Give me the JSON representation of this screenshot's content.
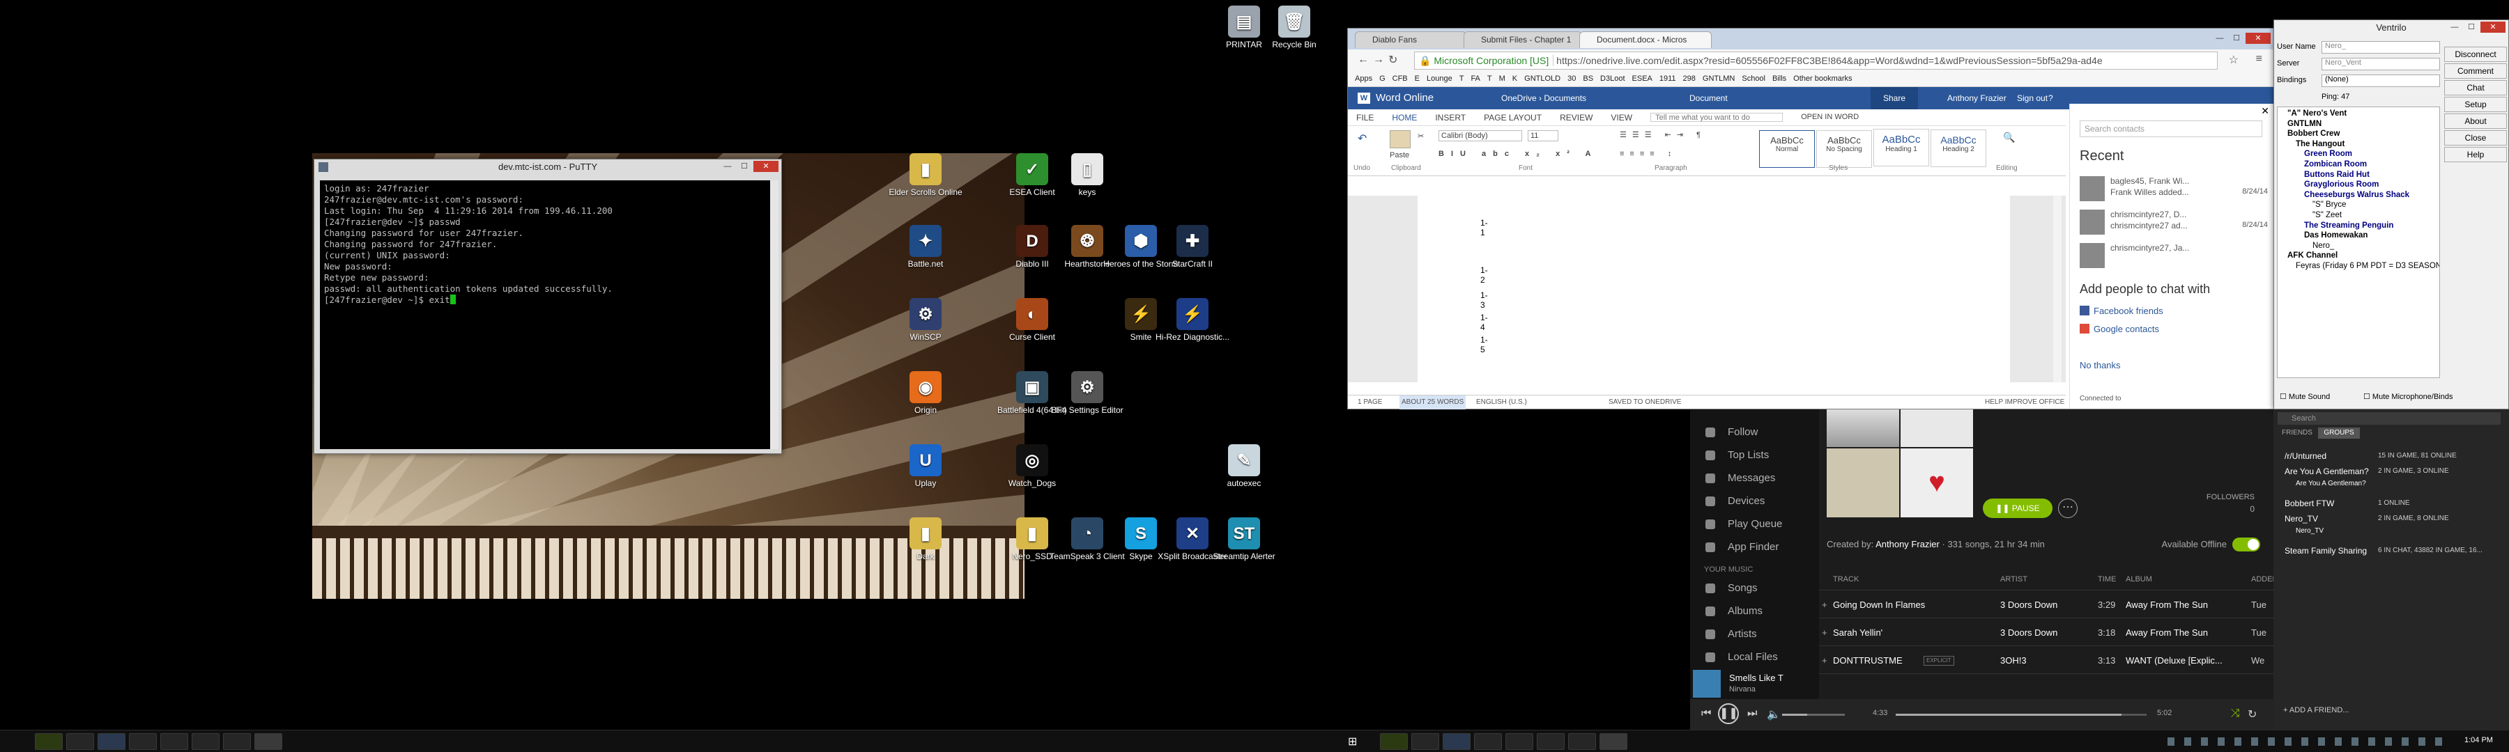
{
  "desktop": {
    "icons": [
      {
        "label": "PRINTAR",
        "glyph": "▤",
        "color": "#9aa3ad"
      },
      {
        "label": "Recycle Bin",
        "glyph": "🗑",
        "color": "#b8c4cc"
      },
      {
        "label": "Elder Scrolls Online",
        "glyph": "▮",
        "color": "#d9b84a"
      },
      {
        "label": "ESEA Client",
        "glyph": "✓",
        "color": "#2e8f2e"
      },
      {
        "label": "keys",
        "glyph": "▯",
        "color": "#e8e8e8"
      },
      {
        "label": "Battle.net",
        "glyph": "✦",
        "color": "#1f4c86"
      },
      {
        "label": "Diablo III",
        "glyph": "D",
        "color": "#4a1d0e"
      },
      {
        "label": "Hearthstone",
        "glyph": "❂",
        "color": "#7a4a1e"
      },
      {
        "label": "Heroes of the Storm",
        "glyph": "⬢",
        "color": "#2b5da8"
      },
      {
        "label": "StarCraft II",
        "glyph": "✚",
        "color": "#1c2d4a"
      },
      {
        "label": "WinSCP",
        "glyph": "⚙",
        "color": "#2f3f6f"
      },
      {
        "label": "Curse Client",
        "glyph": "◐",
        "color": "#a84818"
      },
      {
        "label": "Smite",
        "glyph": "⚡",
        "color": "#3a2a10"
      },
      {
        "label": "Hi-Rez Diagnostic...",
        "glyph": "⚡",
        "color": "#1e3d88"
      },
      {
        "label": "Origin",
        "glyph": "◉",
        "color": "#e66b1a"
      },
      {
        "label": "Battlefield 4(64 bit)",
        "glyph": "▣",
        "color": "#2e4a5c"
      },
      {
        "label": "BF4 Settings Editor",
        "glyph": "⚙",
        "color": "#555"
      },
      {
        "label": "Uplay",
        "glyph": "U",
        "color": "#1b66c9"
      },
      {
        "label": "Watch_Dogs",
        "glyph": "◎",
        "color": "#111"
      },
      {
        "label": "autoexec",
        "glyph": "✎",
        "color": "#c9d6de"
      },
      {
        "label": "Dark",
        "glyph": "▮",
        "color": "#d9b84a"
      },
      {
        "label": "Nero_SSD",
        "glyph": "▮",
        "color": "#d9b84a"
      },
      {
        "label": "TeamSpeak 3 Client",
        "glyph": "◔",
        "color": "#2a4866"
      },
      {
        "label": "Skype",
        "glyph": "S",
        "color": "#15a0e0"
      },
      {
        "label": "XSplit Broadcaster",
        "glyph": "✕",
        "color": "#1e3e88"
      },
      {
        "label": "Streamtip Alerter",
        "glyph": "ST",
        "color": "#1e8fb0"
      }
    ]
  },
  "putty": {
    "title": "dev.mtc-ist.com - PuTTY",
    "lines": [
      "login as: 247frazier",
      "247frazier@dev.mtc-ist.com's password:",
      "Last login: Thu Sep  4 11:29:16 2014 from 199.46.11.200",
      "[247frazier@dev ~]$ passwd",
      "Changing password for user 247frazier.",
      "Changing password for 247frazier.",
      "(current) UNIX password:",
      "New password:",
      "Retype new password:",
      "passwd: all authentication tokens updated successfully.",
      "[247frazier@dev ~]$ exit"
    ]
  },
  "chrome": {
    "tabs": [
      "Diablo Fans",
      "Submit Files - Chapter 1",
      "Document.docx - Micros"
    ],
    "security_label": "Microsoft Corporation [US]",
    "url": "https://onedrive.live.com/edit.aspx?resid=605556F02FF8C3BE!864&app=Word&wdnd=1&wdPreviousSession=5bf5a29a-ad4e",
    "bookmarks": [
      "Apps",
      "G",
      "CFB",
      "E",
      "Lounge",
      "T",
      "FA",
      "T",
      "M",
      "K",
      "GNTLOLD",
      "30",
      "BS",
      "D3Loot",
      "ESEA",
      "1911",
      "298",
      "GNTLMN",
      "School",
      "Bills",
      "Other bookmarks"
    ]
  },
  "word": {
    "app_name": "Word Online",
    "breadcrumb_a": "OneDrive",
    "breadcrumb_b": "Documents",
    "doc_name": "Document",
    "share": "Share",
    "user": "Anthony Frazier",
    "signout": "Sign out",
    "help": "?",
    "tabs": [
      "FILE",
      "HOME",
      "INSERT",
      "PAGE LAYOUT",
      "REVIEW",
      "VIEW"
    ],
    "tell_me": "Tell me what you want to do",
    "open_in_word": "OPEN IN WORD",
    "font": "Calibri (Body)",
    "size": "11",
    "styles": [
      {
        "sample": "AaBbCc",
        "name": "Normal"
      },
      {
        "sample": "AaBbCc",
        "name": "No Spacing"
      },
      {
        "sample": "AaBbCc",
        "name": "Heading 1"
      },
      {
        "sample": "AaBbCc",
        "name": "Heading 2"
      }
    ],
    "groups": [
      "Undo",
      "Clipboard",
      "Font",
      "Paragraph",
      "Styles",
      "Editing"
    ],
    "paste": "Paste",
    "doc_lines": [
      "1-1",
      "1-2",
      "1-3",
      "1-4",
      "1-5"
    ],
    "status": [
      "1 PAGE",
      "ABOUT 25 WORDS",
      "ENGLISH (U.S.)",
      "SAVED TO ONEDRIVE",
      "HELP IMPROVE OFFICE"
    ]
  },
  "skype_panel": {
    "search_placeholder": "Search contacts",
    "recent_title": "Recent",
    "recent": [
      {
        "name": "bagles45, Frank Wi...",
        "msg": "Frank Willes added...",
        "date": "8/24/14"
      },
      {
        "name": "chrismcintyre27, D...",
        "msg": "chrismcintyre27 ad...",
        "date": "8/24/14"
      },
      {
        "name": "chrismcintyre27, Ja...",
        "msg": "",
        "date": ""
      }
    ],
    "add_title": "Add people to chat with",
    "facebook": "Facebook friends",
    "google": "Google contacts",
    "no_thanks": "No thanks",
    "connected": "Connected to"
  },
  "ventrilo": {
    "title": "Ventrilo",
    "user_name_label": "User Name",
    "user_name": "Nero_",
    "server_label": "Server",
    "server": "Nero_Vent",
    "bindings_label": "Bindings",
    "bindings": "(None)",
    "ping": "Ping: 47",
    "tree": [
      "\"A\" Nero's Vent",
      "GNTLMN",
      "Bobbert Crew",
      "The Hangout",
      "Green Room",
      "Zombican Room",
      "Buttons Raid Hut",
      "Grayglorious Room",
      "Cheeseburgs Walrus Shack",
      "\"S\" Bryce",
      "\"S\" Zeet",
      "The Streaming Penguin",
      "Das Homewakan",
      "Nero_",
      "AFK Channel",
      "Feyras (Friday 6 PM PDT = D3 SEASON)"
    ],
    "buttons": [
      "Disconnect",
      "Comment",
      "Chat",
      "Setup",
      "About",
      "Close",
      "Help"
    ],
    "mute_sound": "Mute Sound",
    "mute_mic": "Mute Microphone/Binds"
  },
  "spotify": {
    "nav": [
      "Follow",
      "Top Lists",
      "Messages",
      "Devices",
      "Play Queue",
      "App Finder"
    ],
    "your_music": "YOUR MUSIC",
    "music": [
      "Songs",
      "Albums",
      "Artists",
      "Local Files"
    ],
    "pause": "PAUSE",
    "followers_label": "FOLLOWERS",
    "followers": "0",
    "available_offline": "Available Offline",
    "created_by": "Created by:",
    "creator": "Anthony Frazier",
    "created_meta": "331 songs, 21 hr 34 min",
    "headers": [
      "TRACK",
      "ARTIST",
      "TIME",
      "ALBUM",
      "ADDED"
    ],
    "tracks": [
      {
        "track": "Going Down In Flames",
        "artist": "3 Doors Down",
        "time": "3:29",
        "album": "Away From The Sun",
        "added": "Tue"
      },
      {
        "track": "Sarah Yellin'",
        "artist": "3 Doors Down",
        "time": "3:18",
        "album": "Away From The Sun",
        "added": "Tue"
      },
      {
        "track": "DONTTRUSTME",
        "explicit": "EXPLICIT",
        "artist": "3OH!3",
        "time": "3:13",
        "album": "WANT (Deluxe [Explic...",
        "added": "We"
      }
    ],
    "now_playing_title": "Smells Like T",
    "now_playing_artist": "Nirvana",
    "elapsed": "4:33",
    "duration": "5:02",
    "progress": 0.9
  },
  "steam": {
    "search": "Search",
    "tab_friends": "FRIENDS",
    "tab_groups": "GROUPS",
    "groups": [
      {
        "name": "/r/Unturned",
        "status": "15 IN GAME, 81 ONLINE"
      },
      {
        "name": "Are You A Gentleman?",
        "status": "2 IN GAME, 3 ONLINE"
      },
      {
        "name": "Are You A Gentleman?",
        "status": ""
      },
      {
        "name": "Bobbert FTW",
        "status": "1 ONLINE"
      },
      {
        "name": "Nero_TV",
        "status": "2 IN GAME, 8 ONLINE"
      },
      {
        "name": "Nero_TV",
        "status": ""
      },
      {
        "name": "Steam Family Sharing",
        "status": "6 IN CHAT, 43882 IN GAME, 16..."
      }
    ],
    "add_friend": "+ ADD A FRIEND..."
  },
  "clock": "1:04 PM"
}
